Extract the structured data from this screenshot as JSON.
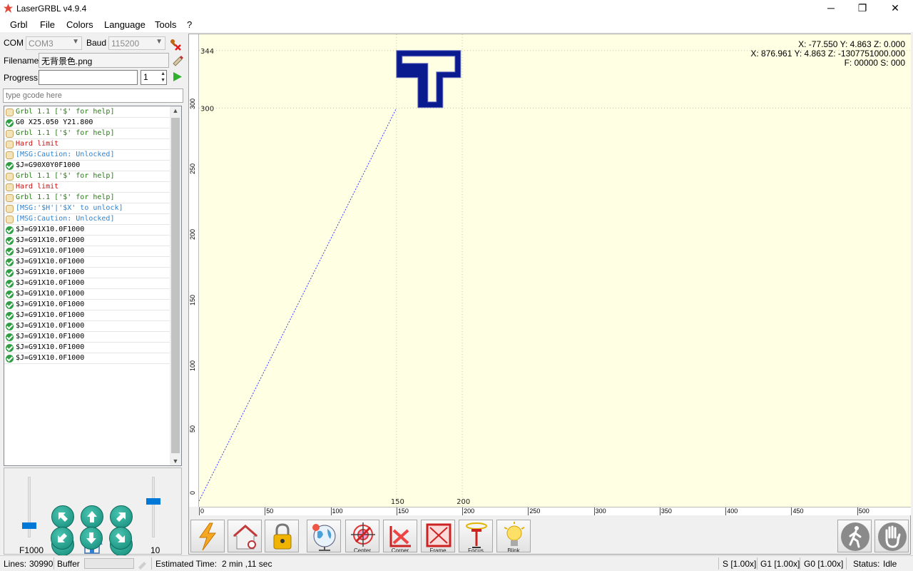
{
  "window": {
    "title": "LaserGRBL v4.9.4",
    "min": "─",
    "restore": "❐",
    "close": "✕"
  },
  "menu": [
    "Grbl",
    "File",
    "Colors",
    "Language",
    "Tools",
    "?"
  ],
  "connection": {
    "com_label": "COM",
    "com_value": "COM3",
    "baud_label": "Baud",
    "baud_value": "115200",
    "filename_label": "Filename",
    "filename_value": "无背景色.png",
    "progress_label": "Progress",
    "passes_value": "1",
    "gcode_placeholder": "type gcode here"
  },
  "console": [
    {
      "text": "Grbl 1.1 ['$' for help]",
      "kind": "info",
      "color": "green"
    },
    {
      "text": "G0 X25.050 Y21.800",
      "kind": "ok",
      "color": "black"
    },
    {
      "text": "Grbl 1.1 ['$' for help]",
      "kind": "info",
      "color": "green"
    },
    {
      "text": "Hard limit",
      "kind": "info",
      "color": "red"
    },
    {
      "text": "[MSG:Caution: Unlocked]",
      "kind": "info",
      "color": "blue"
    },
    {
      "text": "$J=G90X0Y0F1000",
      "kind": "ok",
      "color": "black"
    },
    {
      "text": "Grbl 1.1 ['$' for help]",
      "kind": "info",
      "color": "green"
    },
    {
      "text": "Hard limit",
      "kind": "info",
      "color": "red"
    },
    {
      "text": "Grbl 1.1 ['$' for help]",
      "kind": "info",
      "color": "green"
    },
    {
      "text": "[MSG:'$H'|'$X' to unlock]",
      "kind": "info",
      "color": "blue"
    },
    {
      "text": "[MSG:Caution: Unlocked]",
      "kind": "info",
      "color": "blue"
    },
    {
      "text": "$J=G91X10.0F1000",
      "kind": "ok",
      "color": "black"
    },
    {
      "text": "$J=G91X10.0F1000",
      "kind": "ok",
      "color": "black"
    },
    {
      "text": "$J=G91X10.0F1000",
      "kind": "ok",
      "color": "black"
    },
    {
      "text": "$J=G91X10.0F1000",
      "kind": "ok",
      "color": "black"
    },
    {
      "text": "$J=G91X10.0F1000",
      "kind": "ok",
      "color": "black"
    },
    {
      "text": "$J=G91X10.0F1000",
      "kind": "ok",
      "color": "black"
    },
    {
      "text": "$J=G91X10.0F1000",
      "kind": "ok",
      "color": "black"
    },
    {
      "text": "$J=G91X10.0F1000",
      "kind": "ok",
      "color": "black"
    },
    {
      "text": "$J=G91X10.0F1000",
      "kind": "ok",
      "color": "black"
    },
    {
      "text": "$J=G91X10.0F1000",
      "kind": "ok",
      "color": "black"
    },
    {
      "text": "$J=G91X10.0F1000",
      "kind": "ok",
      "color": "black"
    },
    {
      "text": "$J=G91X10.0F1000",
      "kind": "ok",
      "color": "black"
    },
    {
      "text": "$J=G91X10.0F1000",
      "kind": "ok",
      "color": "black"
    }
  ],
  "jog": {
    "speed_label": "F1000",
    "step_label": "10",
    "speed_level": 0.2,
    "step_level": 0.6
  },
  "coords": {
    "line1": "X: -77.550 Y: 4.863 Z: 0.000",
    "line2": "X: 876.961 Y: 4.863 Z: -1307751000.000",
    "line3": "F: 00000 S: 000"
  },
  "rulers": {
    "x_ticks": [
      "0",
      "50",
      "100",
      "150",
      "200",
      "250",
      "300",
      "350",
      "400",
      "450",
      "500"
    ],
    "y_ticks": [
      "0",
      "50",
      "100",
      "150",
      "200",
      "250",
      "300"
    ],
    "marker_x": [
      "150",
      "200"
    ],
    "marker_y": [
      "344",
      "300"
    ]
  },
  "toolbar": [
    {
      "name": "run-button",
      "icon": "lightning-icon",
      "caption": ""
    },
    {
      "name": "home-button",
      "icon": "home-search-icon",
      "caption": ""
    },
    {
      "name": "unlock-button",
      "icon": "lock-icon",
      "caption": ""
    },
    {
      "name": "world-button",
      "icon": "globe-icon",
      "caption": ""
    },
    {
      "name": "center-button",
      "icon": "target-icon",
      "caption": "Center"
    },
    {
      "name": "corner-button",
      "icon": "corner-icon",
      "caption": "Corner"
    },
    {
      "name": "frame-button",
      "icon": "frame-icon",
      "caption": "Frame"
    },
    {
      "name": "focus-button",
      "icon": "focus-icon",
      "caption": "Focus"
    },
    {
      "name": "blink-button",
      "icon": "bulb-icon",
      "caption": "Blink"
    }
  ],
  "status": {
    "lines_label": "Lines:",
    "lines_value": "30990",
    "buffer_label": "Buffer",
    "time_label": "Estimated Time:",
    "time_value": "2 min ,11 sec",
    "s_override": "S [1.00x]",
    "g1_override": "G1 [1.00x]",
    "g0_override": "G0 [1.00x]",
    "state_label": "Status:",
    "state_value": "Idle"
  },
  "colors": {
    "accent": "#0078d7",
    "canvas_bg": "#ffffe4",
    "design": "#0a1a8f",
    "jog": "#1a9a88"
  }
}
